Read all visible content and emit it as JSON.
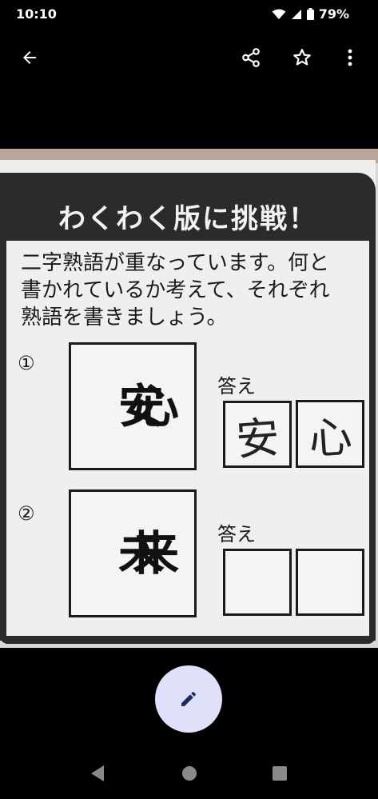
{
  "status_bar": {
    "time": "10:10",
    "battery": "79%"
  },
  "app_bar": {
    "icons": [
      "back-arrow-icon",
      "share-icon",
      "star-icon",
      "more-vert-icon"
    ]
  },
  "photo": {
    "banner": "わくわく版に挑戦！",
    "instruction_lines": [
      "二字熟語が重なっています。何と",
      "書かれているか考えて、それぞれ",
      "熟語を書きましょう。"
    ],
    "questions": [
      {
        "number": "①",
        "kanji": "安心",
        "answer_label": "答え",
        "answers": [
          "安",
          "心"
        ]
      },
      {
        "number": "②",
        "kanji": "未来",
        "answer_label": "答え",
        "answers": [
          "",
          ""
        ]
      }
    ]
  },
  "fab": {
    "icon": "pencil-edit-icon"
  },
  "nav": {
    "icons": [
      "nav-back-icon",
      "nav-home-icon",
      "nav-recents-icon"
    ]
  },
  "colors": {
    "fab_bg": "#dfe1fb",
    "fab_icon": "#1f2a5c",
    "banner": "#2b2b2b"
  }
}
